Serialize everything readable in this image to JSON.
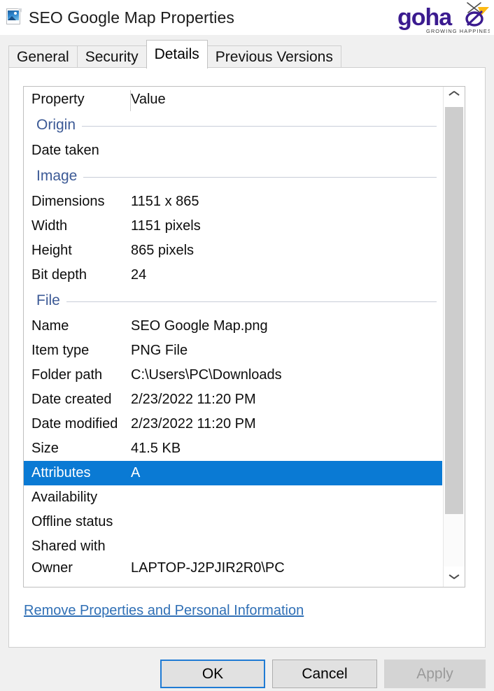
{
  "window": {
    "title": "SEO Google Map Properties",
    "icon": "image-file-icon"
  },
  "brand": {
    "name": "goha",
    "tagline": "GROWING HAPPINESS",
    "color": "#3b1b8f",
    "accent": "#fdb913"
  },
  "tabs": [
    {
      "label": "General",
      "selected": false
    },
    {
      "label": "Security",
      "selected": false
    },
    {
      "label": "Details",
      "selected": true
    },
    {
      "label": "Previous Versions",
      "selected": false
    }
  ],
  "details": {
    "columns": {
      "property": "Property",
      "value": "Value"
    },
    "groups": [
      {
        "name": "Origin",
        "rows": [
          {
            "property": "Date taken",
            "value": ""
          }
        ]
      },
      {
        "name": "Image",
        "rows": [
          {
            "property": "Dimensions",
            "value": "1151 x 865"
          },
          {
            "property": "Width",
            "value": "1151 pixels"
          },
          {
            "property": "Height",
            "value": "865 pixels"
          },
          {
            "property": "Bit depth",
            "value": "24"
          }
        ]
      },
      {
        "name": "File",
        "rows": [
          {
            "property": "Name",
            "value": "SEO Google Map.png"
          },
          {
            "property": "Item type",
            "value": "PNG File"
          },
          {
            "property": "Folder path",
            "value": "C:\\Users\\PC\\Downloads"
          },
          {
            "property": "Date created",
            "value": "2/23/2022 11:20 PM"
          },
          {
            "property": "Date modified",
            "value": "2/23/2022 11:20 PM"
          },
          {
            "property": "Size",
            "value": "41.5 KB"
          },
          {
            "property": "Attributes",
            "value": "A",
            "selected": true
          },
          {
            "property": "Availability",
            "value": ""
          },
          {
            "property": "Offline status",
            "value": ""
          },
          {
            "property": "Shared with",
            "value": ""
          },
          {
            "property": "Owner",
            "value": "LAPTOP-J2PJIR2R0\\PC",
            "clipped": true
          }
        ]
      }
    ],
    "selection_color": "#0a7ad4",
    "group_label_color": "#3c5a96"
  },
  "scrollbar": {
    "up_icon": "chevron-up-icon",
    "down_icon": "chevron-down-icon"
  },
  "link": {
    "label": "Remove Properties and Personal Information"
  },
  "buttons": {
    "ok": "OK",
    "cancel": "Cancel",
    "apply": "Apply",
    "apply_disabled": true
  }
}
